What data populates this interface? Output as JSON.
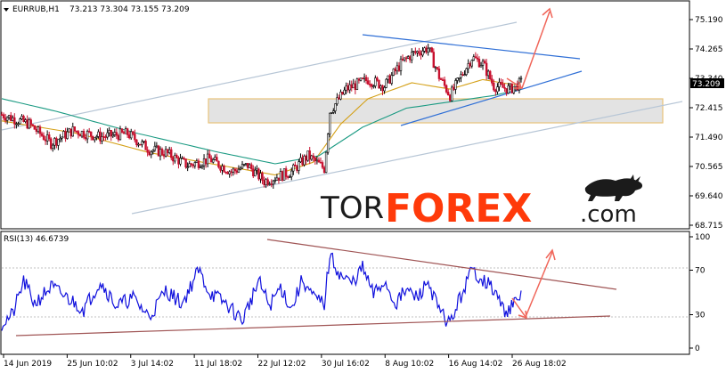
{
  "header": {
    "symbol": "EURRUB,H1",
    "ohlc": "73.213 73.304 73.155 73.209"
  },
  "rsi_header": "RSI(13) 46.6739",
  "logo": {
    "part1": "TOR",
    "part2": "FOREX",
    "part3": ".com"
  },
  "colors": {
    "up_candle": "#000000",
    "down_candle": "#c8102e",
    "ma_fast": "#d4a017",
    "ma_slow": "#1a9a82",
    "channel_outer": "#b7c6d6",
    "channel_inner": "#2f6fd6",
    "rsi_line": "#1010dd",
    "rsi_trend": "#a05555",
    "arrow": "#f0665a",
    "zone_fill": "#d9d9d9",
    "zone_border": "#e8c37a"
  },
  "chart_data": [
    {
      "type": "candlestick",
      "title": "EURRUB,H1",
      "y_ticks": [
        "75.190",
        "74.265",
        "73.340",
        "72.415",
        "71.490",
        "70.565",
        "69.640",
        "68.715"
      ],
      "ylim": [
        68.715,
        75.19
      ],
      "x_ticks": [
        "14 Jun 2019",
        "25 Jun 10:02",
        "3 Jul 14:02",
        "11 Jul 18:02",
        "22 Jul 12:02",
        "30 Jul 16:02",
        "8 Aug 10:02",
        "16 Aug 14:02",
        "26 Aug 18:02"
      ],
      "current_price": "73.209",
      "price_path": [
        [
          0,
          72.2
        ],
        [
          5,
          71.9
        ],
        [
          9,
          71.3
        ],
        [
          13,
          71.7
        ],
        [
          18,
          71.5
        ],
        [
          23,
          71.6
        ],
        [
          27,
          71.1
        ],
        [
          30,
          71.0
        ],
        [
          34,
          70.6
        ],
        [
          38,
          70.8
        ],
        [
          42,
          70.4
        ],
        [
          45,
          70.6
        ],
        [
          48,
          70.1
        ],
        [
          53,
          70.4
        ],
        [
          56,
          70.9
        ],
        [
          59,
          70.5
        ],
        [
          60,
          72.3
        ],
        [
          63,
          73.0
        ],
        [
          67,
          73.3
        ],
        [
          70,
          73.1
        ],
        [
          73,
          73.8
        ],
        [
          75,
          74.1
        ],
        [
          78,
          74.3
        ],
        [
          80,
          73.4
        ],
        [
          82,
          72.8
        ],
        [
          84,
          73.4
        ],
        [
          86,
          74.0
        ],
        [
          88,
          73.8
        ],
        [
          90,
          73.1
        ],
        [
          93,
          73.0
        ],
        [
          95,
          73.2
        ]
      ],
      "moving_averages": [
        {
          "name": "fast",
          "path": [
            [
              0,
              72.0
            ],
            [
              14,
              71.6
            ],
            [
              27,
              71.0
            ],
            [
              40,
              70.6
            ],
            [
              50,
              70.3
            ],
            [
              57,
              70.7
            ],
            [
              62,
              71.9
            ],
            [
              67,
              72.7
            ],
            [
              75,
              73.2
            ],
            [
              82,
              73.0
            ],
            [
              88,
              73.3
            ],
            [
              95,
              73.1
            ]
          ]
        },
        {
          "name": "slow",
          "path": [
            [
              0,
              72.7
            ],
            [
              10,
              72.3
            ],
            [
              25,
              71.6
            ],
            [
              40,
              71.0
            ],
            [
              50,
              70.65
            ],
            [
              58,
              70.9
            ],
            [
              66,
              71.8
            ],
            [
              74,
              72.4
            ],
            [
              82,
              72.6
            ],
            [
              90,
              72.8
            ],
            [
              95,
              73.0
            ]
          ]
        }
      ],
      "support_zone": [
        72.05,
        72.72
      ]
    },
    {
      "type": "line",
      "title": "RSI(13) 46.6739",
      "y_ticks": [
        "100",
        "70",
        "30",
        "0"
      ],
      "ylim": [
        0,
        100
      ],
      "levels": [
        30,
        70
      ],
      "last_value": 46.6739,
      "values_path": [
        [
          0,
          22
        ],
        [
          2,
          30
        ],
        [
          4,
          60
        ],
        [
          6,
          40
        ],
        [
          9,
          55
        ],
        [
          12,
          45
        ],
        [
          15,
          35
        ],
        [
          18,
          60
        ],
        [
          21,
          38
        ],
        [
          24,
          45
        ],
        [
          27,
          28
        ],
        [
          30,
          52
        ],
        [
          33,
          40
        ],
        [
          36,
          70
        ],
        [
          38,
          50
        ],
        [
          41,
          40
        ],
        [
          44,
          25
        ],
        [
          47,
          60
        ],
        [
          49,
          38
        ],
        [
          51,
          55
        ],
        [
          53,
          35
        ],
        [
          55,
          62
        ],
        [
          57,
          45
        ],
        [
          59,
          40
        ],
        [
          60,
          83
        ],
        [
          62,
          65
        ],
        [
          64,
          58
        ],
        [
          66,
          72
        ],
        [
          68,
          48
        ],
        [
          70,
          60
        ],
        [
          72,
          40
        ],
        [
          74,
          52
        ],
        [
          76,
          45
        ],
        [
          78,
          60
        ],
        [
          80,
          33
        ],
        [
          82,
          22
        ],
        [
          84,
          47
        ],
        [
          86,
          70
        ],
        [
          88,
          62
        ],
        [
          90,
          52
        ],
        [
          92,
          33
        ],
        [
          94,
          40
        ],
        [
          95,
          47
        ]
      ]
    }
  ]
}
